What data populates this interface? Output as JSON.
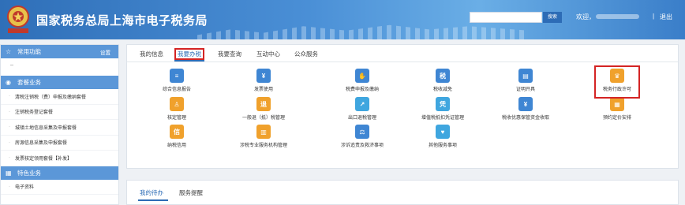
{
  "header": {
    "title": "国家税务总局上海市电子税务局",
    "search_button": "搜索",
    "welcome": "欢迎，",
    "separator": "|",
    "logout": "退出"
  },
  "sidebar": {
    "common": {
      "label": "常用功能",
      "action": "设置",
      "items": [
        "--"
      ]
    },
    "package": {
      "label": "套餐业务",
      "items": [
        "清税注销税（费）申报及缴纳套餐",
        "注销税务登记套餐",
        "城镇土地信息采集及申报套餐",
        "房源信息采集及申报套餐",
        "发票核定领用套餐【补发】"
      ]
    },
    "special": {
      "label": "特色业务",
      "items": [
        "电子资料"
      ]
    }
  },
  "main_tabs": [
    "我的信息",
    "我要办税",
    "我要查询",
    "互动中心",
    "公众服务"
  ],
  "functions": [
    {
      "label": "综合信息报告",
      "icon": "document-icon",
      "color": "#3f86d3",
      "glyph": "≡"
    },
    {
      "label": "发票使用",
      "icon": "invoice-icon",
      "color": "#3f86d3",
      "glyph": "¥"
    },
    {
      "label": "税费申报及缴纳",
      "icon": "tax-payment-icon",
      "color": "#3f86d3",
      "glyph": "✋"
    },
    {
      "label": "税收减免",
      "icon": "tax-reduction-icon",
      "color": "#3f86d3",
      "glyph": "税"
    },
    {
      "label": "证明开具",
      "icon": "certificate-icon",
      "color": "#3f86d3",
      "glyph": "▤"
    },
    {
      "label": "税务行政许可",
      "icon": "admin-license-icon",
      "color": "#f0a12c",
      "glyph": "♛"
    },
    {
      "label": "核定管理",
      "icon": "stamp-icon",
      "color": "#f0a12c",
      "glyph": "♙"
    },
    {
      "label": "一般退（抵）税管理",
      "icon": "refund-icon",
      "color": "#f0a12c",
      "glyph": "退"
    },
    {
      "label": "出口退税管理",
      "icon": "export-refund-icon",
      "color": "#3fa6df",
      "glyph": "↗"
    },
    {
      "label": "增值税抵扣凭证管理",
      "icon": "vat-voucher-icon",
      "color": "#3fa6df",
      "glyph": "凭"
    },
    {
      "label": "税收优惠保管资金收取",
      "icon": "fund-collection-icon",
      "color": "#3f86d3",
      "glyph": "¥"
    },
    {
      "label": "预约定价安排",
      "icon": "calendar-icon",
      "color": "#f0a12c",
      "glyph": "▦"
    },
    {
      "label": "纳税信用",
      "icon": "credit-icon",
      "color": "#f0a12c",
      "glyph": "信"
    },
    {
      "label": "涉税专业服务机构管理",
      "icon": "building-icon",
      "color": "#f0a12c",
      "glyph": "▥"
    },
    {
      "label": "涉诉追责及救济事项",
      "icon": "gavel-icon",
      "color": "#3f86d3",
      "glyph": "⚖"
    },
    {
      "label": "其他服务事项",
      "icon": "heart-hands-icon",
      "color": "#3fa6df",
      "glyph": "♥"
    }
  ],
  "bottom_tabs": [
    "我的待办",
    "服务提醒"
  ]
}
